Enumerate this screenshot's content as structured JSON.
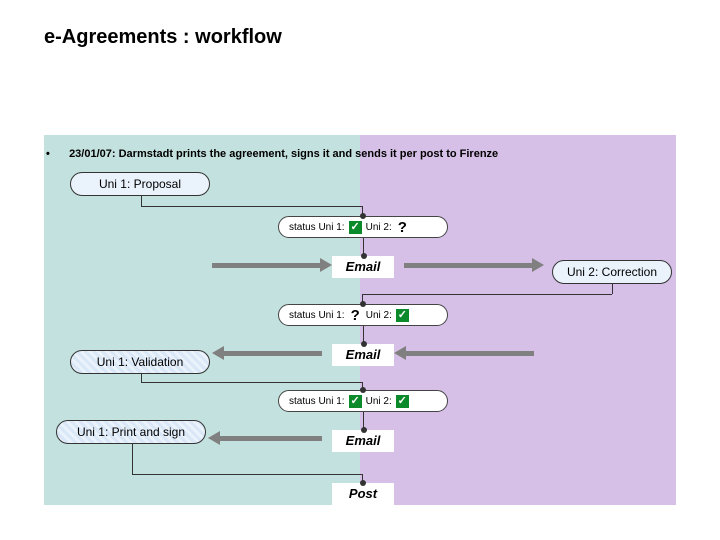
{
  "title": "e-Agreements : workflow",
  "bullet": "23/01/07: Darmstadt prints the agreement, signs it and sends it per post to Firenze",
  "stages": {
    "proposal": "Uni 1: Proposal",
    "correction": "Uni 2: Correction",
    "validation": "Uni 1: Validation",
    "print": "Uni 1: Print and sign"
  },
  "status": {
    "label_uni1": "status Uni 1:",
    "label_uni2": "Uni 2:",
    "check": "✓",
    "question": "?"
  },
  "status_rows": [
    {
      "uni1": "check",
      "uni2": "question"
    },
    {
      "uni1": "question",
      "uni2": "check"
    },
    {
      "uni1": "check",
      "uni2": "check"
    }
  ],
  "email_label": "Email",
  "post_label": "Post"
}
